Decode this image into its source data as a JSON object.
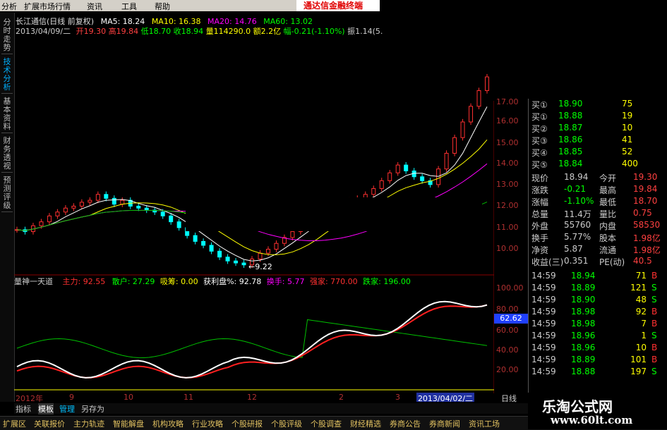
{
  "menu": {
    "items": [
      "分析",
      "扩展市场行情",
      "资讯",
      "工具",
      "帮助"
    ],
    "brand": "通达信金融终端"
  },
  "sidetabs": [
    "分时走势",
    "技术分析",
    "基本资料",
    "财务透视",
    "预测评级"
  ],
  "info": {
    "name": "长江通信(日线 前复权)",
    "ma5": "MA5: 18.24",
    "ma10": "MA10: 16.38",
    "ma20": "MA20: 14.76",
    "ma60": "MA60: 13.02",
    "date": "2013/04/09/二",
    "open": "开19.30",
    "high": "高19.84",
    "low": "低18.70",
    "close": "收18.94",
    "vol": "量114290.0",
    "amt": "额2.2亿",
    "chg": "幅-0.21(-1.10%)",
    "amp": "振1.14(5."
  },
  "annot_low": "←9.22",
  "price_axis": [
    "17.00",
    "16.00",
    "15.00",
    "14.00",
    "13.00",
    "12.00",
    "11.00",
    "10.00"
  ],
  "indicator": {
    "title": "量神一天道",
    "zhuli": "主力: 92.55",
    "sanhu": "散户: 27.29",
    "xichou": "吸筹: 0.00",
    "huoli": "获利盘%: 92.78",
    "huanshou": "换手: 5.77",
    "qiangjia": "强家: 770.00",
    "diejia": "跌家: 196.00",
    "axis": [
      "100.00",
      "80.00",
      "60.00",
      "40.00",
      "20.00"
    ],
    "last_value": "62.62"
  },
  "time_axis": {
    "labels": [
      "2012年",
      "9",
      "10",
      "11",
      "12",
      "2",
      "3"
    ],
    "date_box": "2013/04/02/二",
    "mode": "日线"
  },
  "quotes": {
    "bids": [
      {
        "label": "买①",
        "price": "18.90",
        "vol": "75"
      },
      {
        "label": "买①",
        "price": "18.88",
        "vol": "19"
      },
      {
        "label": "买②",
        "price": "18.87",
        "vol": "10"
      },
      {
        "label": "买③",
        "price": "18.86",
        "vol": "41"
      },
      {
        "label": "买④",
        "price": "18.85",
        "vol": "52"
      },
      {
        "label": "买⑤",
        "price": "18.84",
        "vol": "400"
      }
    ],
    "stats": [
      {
        "k1": "现价",
        "v1": "18.94",
        "k2": "今开",
        "v2": "19.30"
      },
      {
        "k1": "涨跌",
        "v1": "-0.21",
        "k2": "最高",
        "v2": "19.84"
      },
      {
        "k1": "涨幅",
        "v1": "-1.10%",
        "k2": "最低",
        "v2": "18.70"
      },
      {
        "k1": "总量",
        "v1": "11.4万",
        "k2": "量比",
        "v2": "0.75"
      },
      {
        "k1": "外盘",
        "v1": "55760",
        "k2": "内盘",
        "v2": "58530"
      },
      {
        "k1": "换手",
        "v1": "5.77%",
        "k2": "股本",
        "v2": "1.98亿"
      },
      {
        "k1": "净资",
        "v1": "5.87",
        "k2": "流通",
        "v2": "1.98亿"
      },
      {
        "k1": "收益(三)",
        "v1": "0.351",
        "k2": "PE(动)",
        "v2": "40.5"
      }
    ],
    "ticks": [
      {
        "t": "14:59",
        "p": "18.94",
        "v": "71",
        "d": "B"
      },
      {
        "t": "14:59",
        "p": "18.89",
        "v": "121",
        "d": "S"
      },
      {
        "t": "14:59",
        "p": "18.90",
        "v": "48",
        "d": "S"
      },
      {
        "t": "14:59",
        "p": "18.98",
        "v": "92",
        "d": "B"
      },
      {
        "t": "14:59",
        "p": "18.98",
        "v": "7",
        "d": "B"
      },
      {
        "t": "14:59",
        "p": "18.96",
        "v": "1",
        "d": "S"
      },
      {
        "t": "14:59",
        "p": "18.96",
        "v": "10",
        "d": "B"
      },
      {
        "t": "14:59",
        "p": "18.89",
        "v": "101",
        "d": "B"
      },
      {
        "t": "14:59",
        "p": "18.88",
        "v": "197",
        "d": "S"
      }
    ]
  },
  "bottom_tabs": [
    "指标",
    "模板",
    "管理",
    "另存为"
  ],
  "bottom_bar": [
    "扩展区",
    "关联报价",
    "主力轨迹",
    "智能解盘",
    "机构攻略",
    "行业攻略",
    "个股研报",
    "个股评级",
    "个股调查",
    "财经精选",
    "券商公告",
    "券商新闻",
    "资讯工场"
  ],
  "logo": {
    "title": "乐淘公式网",
    "url": "www.60lt.com"
  },
  "chart_data": {
    "type": "line",
    "title": "长江通信(日线 前复权)",
    "price_range": [
      9.22,
      17.5
    ],
    "price_close": [
      11.1,
      11.0,
      11.3,
      11.5,
      11.8,
      12.0,
      12.2,
      12.3,
      12.5,
      12.6,
      12.9,
      12.7,
      12.4,
      12.6,
      12.3,
      12.2,
      12.1,
      12.0,
      11.8,
      11.5,
      11.2,
      10.8,
      10.5,
      10.3,
      10.0,
      9.7,
      9.5,
      9.4,
      9.3,
      9.6,
      9.9,
      10.1,
      10.4,
      10.7,
      11.0,
      11.4,
      11.6,
      12.0,
      12.3,
      12.5,
      12.4,
      12.6,
      12.7,
      12.9,
      13.2,
      13.6,
      14.0,
      14.4,
      14.1,
      13.8,
      13.6,
      13.4,
      14.2,
      15.0,
      15.8,
      16.6,
      17.4,
      18.2,
      18.9
    ],
    "indicator_range": [
      0,
      100
    ]
  }
}
